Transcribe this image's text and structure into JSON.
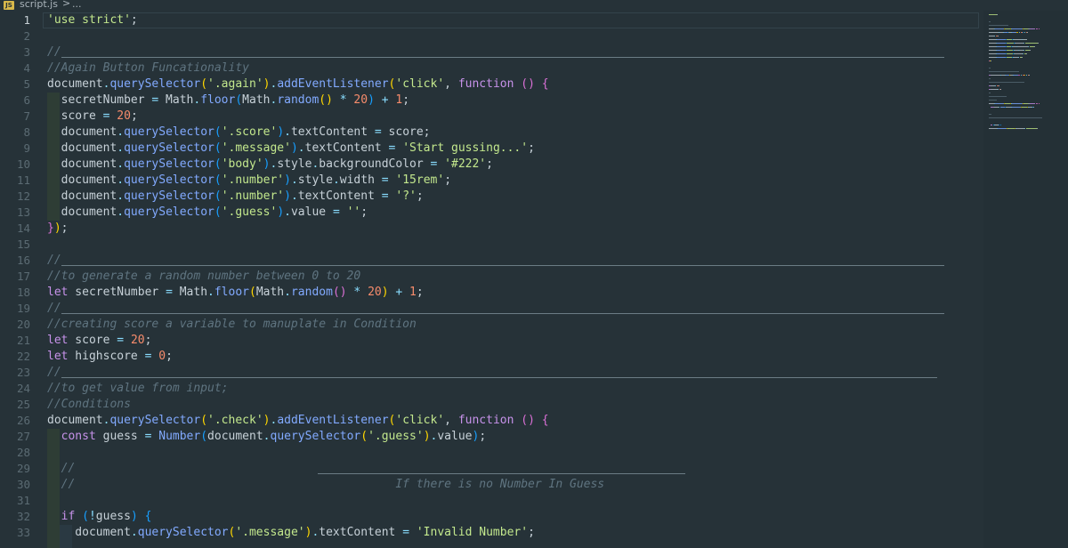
{
  "breadcrumb": {
    "file_icon": "javascript-file-icon",
    "file_name": "script.js",
    "separator": ">",
    "more": "..."
  },
  "editor": {
    "active_line": 1,
    "lines": [
      {
        "n": "1",
        "tokens": [
          {
            "t": "'use strict'",
            "c": "str"
          },
          {
            "t": ";",
            "c": "pn"
          }
        ]
      },
      {
        "n": "2",
        "tokens": []
      },
      {
        "n": "3",
        "tokens": [
          {
            "t": "//",
            "c": "cm"
          }
        ]
      },
      {
        "n": "4",
        "tokens": [
          {
            "t": "//Again Button Funcationality",
            "c": "cm"
          }
        ]
      },
      {
        "n": "5",
        "tokens": [
          {
            "t": "document",
            "c": "pn"
          },
          {
            "t": ".",
            "c": "op"
          },
          {
            "t": "querySelector",
            "c": "fn"
          },
          {
            "t": "(",
            "c": "br-y"
          },
          {
            "t": "'.again'",
            "c": "str"
          },
          {
            "t": ")",
            "c": "br-y"
          },
          {
            "t": ".",
            "c": "op"
          },
          {
            "t": "addEventListener",
            "c": "fn"
          },
          {
            "t": "(",
            "c": "br-y"
          },
          {
            "t": "'click'",
            "c": "str"
          },
          {
            "t": ", ",
            "c": "pn"
          },
          {
            "t": "function",
            "c": "kw"
          },
          {
            "t": " ",
            "c": "pn"
          },
          {
            "t": "()",
            "c": "br-p"
          },
          {
            "t": " ",
            "c": "pn"
          },
          {
            "t": "{",
            "c": "br-p"
          }
        ]
      },
      {
        "n": "6",
        "tokens": [
          {
            "t": "  secretNumber ",
            "c": "pn"
          },
          {
            "t": "=",
            "c": "op"
          },
          {
            "t": " Math",
            "c": "pn"
          },
          {
            "t": ".",
            "c": "op"
          },
          {
            "t": "floor",
            "c": "fn"
          },
          {
            "t": "(",
            "c": "br-b"
          },
          {
            "t": "Math",
            "c": "pn"
          },
          {
            "t": ".",
            "c": "op"
          },
          {
            "t": "random",
            "c": "fn"
          },
          {
            "t": "()",
            "c": "br-y"
          },
          {
            "t": " ",
            "c": "pn"
          },
          {
            "t": "*",
            "c": "op"
          },
          {
            "t": " ",
            "c": "pn"
          },
          {
            "t": "20",
            "c": "num"
          },
          {
            "t": ")",
            "c": "br-b"
          },
          {
            "t": " ",
            "c": "pn"
          },
          {
            "t": "+",
            "c": "op"
          },
          {
            "t": " ",
            "c": "pn"
          },
          {
            "t": "1",
            "c": "num"
          },
          {
            "t": ";",
            "c": "pn"
          }
        ]
      },
      {
        "n": "7",
        "tokens": [
          {
            "t": "  score ",
            "c": "pn"
          },
          {
            "t": "=",
            "c": "op"
          },
          {
            "t": " ",
            "c": "pn"
          },
          {
            "t": "20",
            "c": "num"
          },
          {
            "t": ";",
            "c": "pn"
          }
        ]
      },
      {
        "n": "8",
        "tokens": [
          {
            "t": "  document",
            "c": "pn"
          },
          {
            "t": ".",
            "c": "op"
          },
          {
            "t": "querySelector",
            "c": "fn"
          },
          {
            "t": "(",
            "c": "br-b"
          },
          {
            "t": "'.score'",
            "c": "str"
          },
          {
            "t": ")",
            "c": "br-b"
          },
          {
            "t": ".",
            "c": "op"
          },
          {
            "t": "textContent ",
            "c": "pn"
          },
          {
            "t": "=",
            "c": "op"
          },
          {
            "t": " score;",
            "c": "pn"
          }
        ]
      },
      {
        "n": "9",
        "tokens": [
          {
            "t": "  document",
            "c": "pn"
          },
          {
            "t": ".",
            "c": "op"
          },
          {
            "t": "querySelector",
            "c": "fn"
          },
          {
            "t": "(",
            "c": "br-b"
          },
          {
            "t": "'.message'",
            "c": "str"
          },
          {
            "t": ")",
            "c": "br-b"
          },
          {
            "t": ".",
            "c": "op"
          },
          {
            "t": "textContent ",
            "c": "pn"
          },
          {
            "t": "=",
            "c": "op"
          },
          {
            "t": " ",
            "c": "pn"
          },
          {
            "t": "'Start gussing...'",
            "c": "str"
          },
          {
            "t": ";",
            "c": "pn"
          }
        ]
      },
      {
        "n": "10",
        "tokens": [
          {
            "t": "  document",
            "c": "pn"
          },
          {
            "t": ".",
            "c": "op"
          },
          {
            "t": "querySelector",
            "c": "fn"
          },
          {
            "t": "(",
            "c": "br-b"
          },
          {
            "t": "'body'",
            "c": "str"
          },
          {
            "t": ")",
            "c": "br-b"
          },
          {
            "t": ".",
            "c": "op"
          },
          {
            "t": "style",
            "c": "pn"
          },
          {
            "t": ".",
            "c": "op"
          },
          {
            "t": "backgroundColor ",
            "c": "pn"
          },
          {
            "t": "=",
            "c": "op"
          },
          {
            "t": " ",
            "c": "pn"
          },
          {
            "t": "'#222'",
            "c": "str"
          },
          {
            "t": ";",
            "c": "pn"
          }
        ]
      },
      {
        "n": "11",
        "tokens": [
          {
            "t": "  document",
            "c": "pn"
          },
          {
            "t": ".",
            "c": "op"
          },
          {
            "t": "querySelector",
            "c": "fn"
          },
          {
            "t": "(",
            "c": "br-b"
          },
          {
            "t": "'.number'",
            "c": "str"
          },
          {
            "t": ")",
            "c": "br-b"
          },
          {
            "t": ".",
            "c": "op"
          },
          {
            "t": "style",
            "c": "pn"
          },
          {
            "t": ".",
            "c": "op"
          },
          {
            "t": "width ",
            "c": "pn"
          },
          {
            "t": "=",
            "c": "op"
          },
          {
            "t": " ",
            "c": "pn"
          },
          {
            "t": "'15rem'",
            "c": "str"
          },
          {
            "t": ";",
            "c": "pn"
          }
        ]
      },
      {
        "n": "12",
        "tokens": [
          {
            "t": "  document",
            "c": "pn"
          },
          {
            "t": ".",
            "c": "op"
          },
          {
            "t": "querySelector",
            "c": "fn"
          },
          {
            "t": "(",
            "c": "br-b"
          },
          {
            "t": "'.number'",
            "c": "str"
          },
          {
            "t": ")",
            "c": "br-b"
          },
          {
            "t": ".",
            "c": "op"
          },
          {
            "t": "textContent ",
            "c": "pn"
          },
          {
            "t": "=",
            "c": "op"
          },
          {
            "t": " ",
            "c": "pn"
          },
          {
            "t": "'?'",
            "c": "str"
          },
          {
            "t": ";",
            "c": "pn"
          }
        ]
      },
      {
        "n": "13",
        "tokens": [
          {
            "t": "  document",
            "c": "pn"
          },
          {
            "t": ".",
            "c": "op"
          },
          {
            "t": "querySelector",
            "c": "fn"
          },
          {
            "t": "(",
            "c": "br-b"
          },
          {
            "t": "'.guess'",
            "c": "str"
          },
          {
            "t": ")",
            "c": "br-b"
          },
          {
            "t": ".",
            "c": "op"
          },
          {
            "t": "value ",
            "c": "pn"
          },
          {
            "t": "=",
            "c": "op"
          },
          {
            "t": " ",
            "c": "pn"
          },
          {
            "t": "''",
            "c": "str"
          },
          {
            "t": ";",
            "c": "pn"
          }
        ]
      },
      {
        "n": "14",
        "tokens": [
          {
            "t": "}",
            "c": "br-p"
          },
          {
            "t": ")",
            "c": "br-y"
          },
          {
            "t": ";",
            "c": "pn"
          }
        ]
      },
      {
        "n": "15",
        "tokens": []
      },
      {
        "n": "16",
        "tokens": [
          {
            "t": "//",
            "c": "cm"
          }
        ]
      },
      {
        "n": "17",
        "tokens": [
          {
            "t": "//to generate a random number between 0 to 20",
            "c": "cm"
          }
        ]
      },
      {
        "n": "18",
        "tokens": [
          {
            "t": "let",
            "c": "kw"
          },
          {
            "t": " secretNumber ",
            "c": "pn"
          },
          {
            "t": "=",
            "c": "op"
          },
          {
            "t": " Math",
            "c": "pn"
          },
          {
            "t": ".",
            "c": "op"
          },
          {
            "t": "floor",
            "c": "fn"
          },
          {
            "t": "(",
            "c": "br-y"
          },
          {
            "t": "Math",
            "c": "pn"
          },
          {
            "t": ".",
            "c": "op"
          },
          {
            "t": "random",
            "c": "fn"
          },
          {
            "t": "()",
            "c": "br-p"
          },
          {
            "t": " ",
            "c": "pn"
          },
          {
            "t": "*",
            "c": "op"
          },
          {
            "t": " ",
            "c": "pn"
          },
          {
            "t": "20",
            "c": "num"
          },
          {
            "t": ")",
            "c": "br-y"
          },
          {
            "t": " ",
            "c": "pn"
          },
          {
            "t": "+",
            "c": "op"
          },
          {
            "t": " ",
            "c": "pn"
          },
          {
            "t": "1",
            "c": "num"
          },
          {
            "t": ";",
            "c": "pn"
          }
        ]
      },
      {
        "n": "19",
        "tokens": [
          {
            "t": "//",
            "c": "cm"
          }
        ]
      },
      {
        "n": "20",
        "tokens": [
          {
            "t": "//creating score a variable to manuplate in Condition",
            "c": "cm"
          }
        ]
      },
      {
        "n": "21",
        "tokens": [
          {
            "t": "let",
            "c": "kw"
          },
          {
            "t": " score ",
            "c": "pn"
          },
          {
            "t": "=",
            "c": "op"
          },
          {
            "t": " ",
            "c": "pn"
          },
          {
            "t": "20",
            "c": "num"
          },
          {
            "t": ";",
            "c": "pn"
          }
        ]
      },
      {
        "n": "22",
        "tokens": [
          {
            "t": "let",
            "c": "kw"
          },
          {
            "t": " highscore ",
            "c": "pn"
          },
          {
            "t": "=",
            "c": "op"
          },
          {
            "t": " ",
            "c": "pn"
          },
          {
            "t": "0",
            "c": "num"
          },
          {
            "t": ";",
            "c": "pn"
          }
        ]
      },
      {
        "n": "23",
        "tokens": [
          {
            "t": "//",
            "c": "cm"
          }
        ]
      },
      {
        "n": "24",
        "tokens": [
          {
            "t": "//to get value from input;",
            "c": "cm"
          }
        ]
      },
      {
        "n": "25",
        "tokens": [
          {
            "t": "//Conditions",
            "c": "cm"
          }
        ]
      },
      {
        "n": "26",
        "tokens": [
          {
            "t": "document",
            "c": "pn"
          },
          {
            "t": ".",
            "c": "op"
          },
          {
            "t": "querySelector",
            "c": "fn"
          },
          {
            "t": "(",
            "c": "br-y"
          },
          {
            "t": "'.check'",
            "c": "str"
          },
          {
            "t": ")",
            "c": "br-y"
          },
          {
            "t": ".",
            "c": "op"
          },
          {
            "t": "addEventListener",
            "c": "fn"
          },
          {
            "t": "(",
            "c": "br-y"
          },
          {
            "t": "'click'",
            "c": "str"
          },
          {
            "t": ", ",
            "c": "pn"
          },
          {
            "t": "function",
            "c": "kw"
          },
          {
            "t": " ",
            "c": "pn"
          },
          {
            "t": "()",
            "c": "br-p"
          },
          {
            "t": " ",
            "c": "pn"
          },
          {
            "t": "{",
            "c": "br-p"
          }
        ]
      },
      {
        "n": "27",
        "tokens": [
          {
            "t": "  ",
            "c": "pn"
          },
          {
            "t": "const",
            "c": "kw"
          },
          {
            "t": " guess ",
            "c": "pn"
          },
          {
            "t": "=",
            "c": "op"
          },
          {
            "t": " ",
            "c": "pn"
          },
          {
            "t": "Number",
            "c": "fn"
          },
          {
            "t": "(",
            "c": "br-b"
          },
          {
            "t": "document",
            "c": "pn"
          },
          {
            "t": ".",
            "c": "op"
          },
          {
            "t": "querySelector",
            "c": "fn"
          },
          {
            "t": "(",
            "c": "br-y"
          },
          {
            "t": "'.guess'",
            "c": "str"
          },
          {
            "t": ")",
            "c": "br-y"
          },
          {
            "t": ".",
            "c": "op"
          },
          {
            "t": "value",
            "c": "pn"
          },
          {
            "t": ")",
            "c": "br-b"
          },
          {
            "t": ";",
            "c": "pn"
          }
        ]
      },
      {
        "n": "28",
        "tokens": []
      },
      {
        "n": "29",
        "tokens": [
          {
            "t": "  //",
            "c": "cm"
          }
        ]
      },
      {
        "n": "30",
        "tokens": [
          {
            "t": "  //                                              If there is no Number In Guess",
            "c": "cm"
          }
        ]
      },
      {
        "n": "31",
        "tokens": []
      },
      {
        "n": "32",
        "tokens": [
          {
            "t": "  ",
            "c": "pn"
          },
          {
            "t": "if",
            "c": "kw"
          },
          {
            "t": " ",
            "c": "pn"
          },
          {
            "t": "(",
            "c": "br-b"
          },
          {
            "t": "!",
            "c": "op"
          },
          {
            "t": "guess",
            "c": "pn"
          },
          {
            "t": ")",
            "c": "br-b"
          },
          {
            "t": " ",
            "c": "pn"
          },
          {
            "t": "{",
            "c": "br-b"
          }
        ]
      },
      {
        "n": "33",
        "tokens": [
          {
            "t": "    document",
            "c": "pn"
          },
          {
            "t": ".",
            "c": "op"
          },
          {
            "t": "querySelector",
            "c": "fn"
          },
          {
            "t": "(",
            "c": "br-y"
          },
          {
            "t": "'.message'",
            "c": "str"
          },
          {
            "t": ")",
            "c": "br-y"
          },
          {
            "t": ".",
            "c": "op"
          },
          {
            "t": "textContent ",
            "c": "pn"
          },
          {
            "t": "=",
            "c": "op"
          },
          {
            "t": " ",
            "c": "pn"
          },
          {
            "t": "'Invalid Number'",
            "c": "str"
          },
          {
            "t": ";",
            "c": "pn"
          }
        ]
      }
    ]
  },
  "colors": {
    "background": "#263238",
    "string": "#c3e88d",
    "function": "#82aaff",
    "keyword": "#c792ea",
    "number": "#f78c6c",
    "operator": "#89ddff",
    "comment": "#5f7480"
  }
}
